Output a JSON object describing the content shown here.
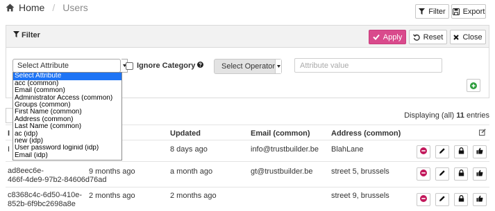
{
  "header": {
    "breadcrumb_home": "Home",
    "breadcrumb_current": "Users",
    "filter_button": "Filter",
    "export_button": "Export"
  },
  "filter_panel": {
    "title": "Filter",
    "apply_label": "Apply",
    "reset_label": "Reset",
    "close_label": "Close",
    "attribute_select_value": "Select Attribute",
    "ignore_category_label": "Ignore Category",
    "ignore_category_checked": false,
    "operator_select_value": "Select Operator",
    "attribute_value_placeholder": "Attribute value",
    "attribute_options": [
      "Select Attribute",
      "acc (common)",
      "Email (common)",
      "Administrator Access (common)",
      "Groups (common)",
      "First Name (common)",
      "Address (common)",
      "Last Name (common)",
      "ac (idp)",
      "new (idp)",
      "User password loginid (idp)",
      "Email (idp)"
    ],
    "highlighted_option": "Select Attribute"
  },
  "table": {
    "displaying_prefix": "Displaying (all)",
    "displaying_count": "11",
    "displaying_suffix": "entries",
    "columns": {
      "id": "I",
      "updated": "Updated",
      "email": "Email (common)",
      "address": "Address (common)"
    },
    "rows": [
      {
        "id_line1": "I",
        "id_line2": "",
        "created": "",
        "updated": "8 days ago",
        "email": "info@trustbuilder.be",
        "address": "BlahLane"
      },
      {
        "id_line1": "ad8eec6e-",
        "id_line2": "466f-4de9-97b2-84606d76ad",
        "created": "9 months ago",
        "updated": "a month ago",
        "email": "gt@trustbuilder.be",
        "address": "street 5, brussels"
      },
      {
        "id_line1": "c8368c4c-6d50-410e-",
        "id_line2": "852b-6f9bc2698a8e",
        "created": "2 months ago",
        "updated": "2 months ago",
        "email": "",
        "address": "street 9, brussels"
      }
    ]
  },
  "colors": {
    "apply_accent": "#d94a8c",
    "add_green": "#2e9e3e",
    "remove_magenta": "#c2185b",
    "dropdown_highlight": "#1e74f5"
  },
  "icons": [
    "home-icon",
    "filter-icon",
    "save-icon",
    "check-icon",
    "reset-icon",
    "close-icon",
    "question-icon",
    "plus-icon",
    "edit-columns-icon",
    "remove-icon",
    "pencil-icon",
    "lock-icon",
    "thumbs-up-icon"
  ]
}
